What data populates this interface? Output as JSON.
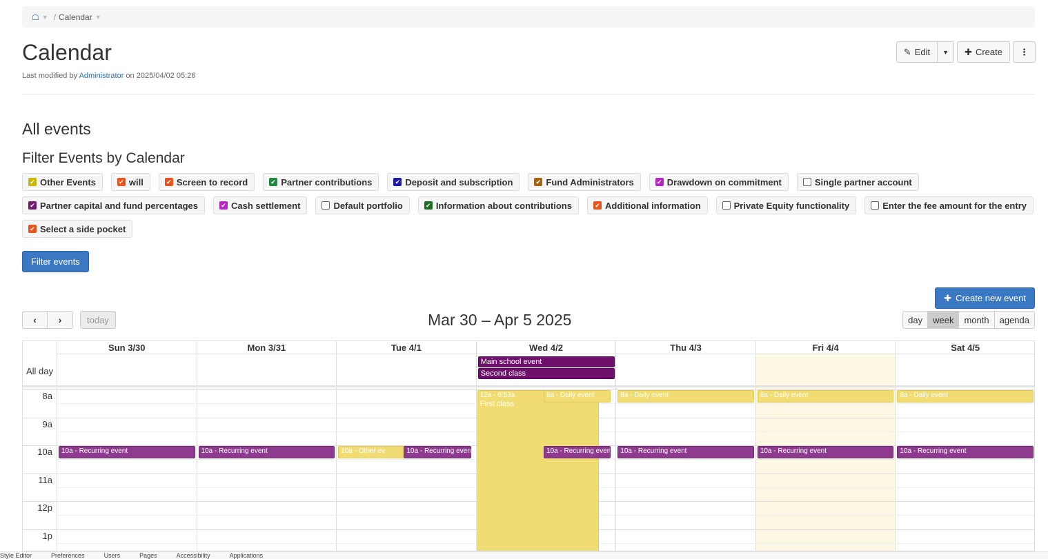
{
  "breadcrumb": {
    "current": "Calendar"
  },
  "page": {
    "title": "Calendar",
    "modified_prefix": "Last modified by",
    "modified_user": "Administrator",
    "modified_suffix": "on 2025/04/02 05:26"
  },
  "actions": {
    "edit": "Edit",
    "create": "Create"
  },
  "sections": {
    "all_events": "All events",
    "filter_heading": "Filter Events by Calendar"
  },
  "filters": [
    {
      "label": "Other Events",
      "checked": true,
      "color": "#c9b800"
    },
    {
      "label": "will",
      "checked": true,
      "color": "#e8541c"
    },
    {
      "label": "Screen to record",
      "checked": true,
      "color": "#e8541c"
    },
    {
      "label": "Partner contributions",
      "checked": true,
      "color": "#1f8b3a"
    },
    {
      "label": "Deposit and subscription",
      "checked": true,
      "color": "#1a1aa6"
    },
    {
      "label": "Fund Administrators",
      "checked": true,
      "color": "#a8650e"
    },
    {
      "label": "Drawdown on commitment",
      "checked": true,
      "color": "#b526c4"
    },
    {
      "label": "Single partner account",
      "checked": false,
      "color": "#ffffff"
    },
    {
      "label": "Partner capital and fund percentages",
      "checked": true,
      "color": "#6f1a6f"
    },
    {
      "label": "Cash settlement",
      "checked": true,
      "color": "#b526c4"
    },
    {
      "label": "Default portfolio",
      "checked": false,
      "color": "#ffffff"
    },
    {
      "label": "Information about contributions",
      "checked": true,
      "color": "#1f6b1f"
    },
    {
      "label": "Additional information",
      "checked": true,
      "color": "#e8541c"
    },
    {
      "label": "Private Equity functionality",
      "checked": false,
      "color": "#ffffff"
    },
    {
      "label": "Enter the fee amount for the entry",
      "checked": false,
      "color": "#ffffff"
    },
    {
      "label": "Select a side pocket",
      "checked": true,
      "color": "#e8541c"
    }
  ],
  "filter_button": "Filter events",
  "create_event_button": "Create new event",
  "calendar": {
    "today_label": "today",
    "range_title": "Mar 30 – Apr 5 2025",
    "views": [
      "day",
      "week",
      "month",
      "agenda"
    ],
    "active_view": "week",
    "allday_label": "All day",
    "days": [
      "Sun 3/30",
      "Mon 3/31",
      "Tue 4/1",
      "Wed 4/2",
      "Thu 4/3",
      "Fri 4/4",
      "Sat 4/5"
    ],
    "today_index": 5,
    "hours": [
      "8a",
      "9a",
      "10a",
      "11a",
      "12p",
      "1p"
    ],
    "allday_events": [
      {
        "day": 3,
        "title": "Main school event"
      },
      {
        "day": 3,
        "title": "Second class"
      }
    ],
    "events": [
      {
        "day": 0,
        "label": "10a - Recurring event",
        "color": "purple",
        "start": 10,
        "end": 10.5,
        "slot": "full"
      },
      {
        "day": 1,
        "label": "10a - Recurring event",
        "color": "purple",
        "start": 10,
        "end": 10.5,
        "slot": "full"
      },
      {
        "day": 2,
        "label": "10a - Other ev",
        "color": "yellow",
        "start": 10,
        "end": 10.5,
        "slot": "left"
      },
      {
        "day": 2,
        "label": "10a - Recurring event",
        "color": "purple",
        "start": 10,
        "end": 10.5,
        "slot": "right"
      },
      {
        "day": 3,
        "label": "12a - 6:53a",
        "sub": "First class",
        "color": "yellow",
        "start": 8,
        "end": 14,
        "slot": "bigleft"
      },
      {
        "day": 3,
        "label": "8a - Daily event",
        "color": "yellow",
        "start": 8,
        "end": 8.5,
        "slot": "right"
      },
      {
        "day": 3,
        "label": "10a - Recurring event",
        "color": "purple",
        "start": 10,
        "end": 10.5,
        "slot": "right"
      },
      {
        "day": 4,
        "label": "8a - Daily event",
        "color": "yellow",
        "start": 8,
        "end": 8.5,
        "slot": "full"
      },
      {
        "day": 4,
        "label": "10a - Recurring event",
        "color": "purple",
        "start": 10,
        "end": 10.5,
        "slot": "full"
      },
      {
        "day": 5,
        "label": "8a - Daily event",
        "color": "yellow",
        "start": 8,
        "end": 8.5,
        "slot": "full"
      },
      {
        "day": 5,
        "label": "10a - Recurring event",
        "color": "purple",
        "start": 10,
        "end": 10.5,
        "slot": "full"
      },
      {
        "day": 6,
        "label": "8a - Daily event",
        "color": "yellow",
        "start": 8,
        "end": 8.5,
        "slot": "full"
      },
      {
        "day": 6,
        "label": "10a - Recurring event",
        "color": "purple",
        "start": 10,
        "end": 10.5,
        "slot": "full"
      }
    ]
  },
  "footer": [
    "Style Editor",
    "Preferences",
    "Users",
    "Pages",
    "Accessibility",
    "Applications"
  ]
}
